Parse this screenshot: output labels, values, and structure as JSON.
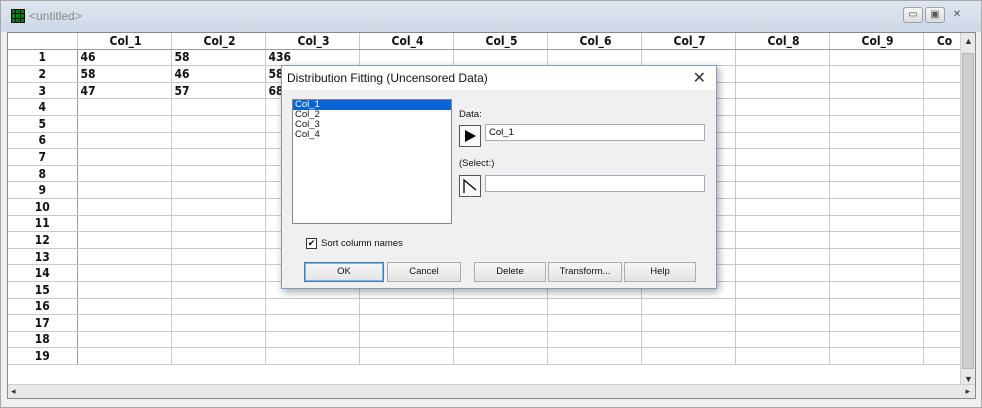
{
  "window": {
    "title": "<untitled>",
    "controls": [
      "▭",
      "▣",
      "✕"
    ]
  },
  "sheet": {
    "columns": [
      "Col_1",
      "Col_2",
      "Col_3",
      "Col_4",
      "Col_5",
      "Col_6",
      "Col_7",
      "Col_8",
      "Col_9",
      "Co"
    ],
    "rows": [
      {
        "label": "1",
        "cells": [
          "46",
          "58",
          "436"
        ]
      },
      {
        "label": "2",
        "cells": [
          "58",
          "46",
          "58"
        ]
      },
      {
        "label": "3",
        "cells": [
          "47",
          "57",
          "68"
        ]
      },
      {
        "label": "4",
        "cells": []
      },
      {
        "label": "5",
        "cells": []
      },
      {
        "label": "6",
        "cells": []
      },
      {
        "label": "7",
        "cells": []
      },
      {
        "label": "8",
        "cells": []
      },
      {
        "label": "9",
        "cells": []
      },
      {
        "label": "10",
        "cells": []
      },
      {
        "label": "11",
        "cells": []
      },
      {
        "label": "12",
        "cells": []
      },
      {
        "label": "13",
        "cells": []
      },
      {
        "label": "14",
        "cells": []
      },
      {
        "label": "15",
        "cells": []
      },
      {
        "label": "16",
        "cells": []
      },
      {
        "label": "17",
        "cells": []
      },
      {
        "label": "18",
        "cells": []
      },
      {
        "label": "19",
        "cells": []
      }
    ]
  },
  "dialog": {
    "title": "Distribution Fitting (Uncensored Data)",
    "close": "✕",
    "list_items": [
      "Col_1",
      "Col_2",
      "Col_3",
      "Col_4"
    ],
    "selected_index": 0,
    "data_label": "Data:",
    "data_value": "Col_1",
    "select_label": "(Select:)",
    "select_value": "",
    "sort_label": "Sort column names",
    "sort_checked": true,
    "buttons": {
      "ok": "OK",
      "cancel": "Cancel",
      "delete": "Delete",
      "transform": "Transform...",
      "help": "Help"
    }
  }
}
